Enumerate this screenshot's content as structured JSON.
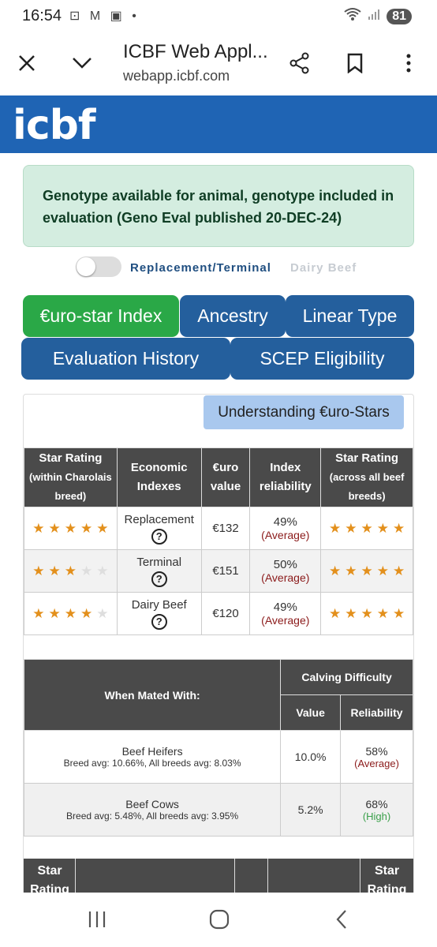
{
  "status_bar": {
    "time": "16:54",
    "notification_icons": "⊡ M ▣ •",
    "battery": "81"
  },
  "browser": {
    "title": "ICBF Web Appl...",
    "url": "webapp.icbf.com"
  },
  "logo_text": "icbf",
  "alert_text": "Genotype available for animal, genotype included in evaluation (Geno Eval published 20-DEC-24)",
  "toggle": {
    "label_on": "Replacement/Terminal",
    "label_off": "Dairy Beef"
  },
  "tabs": [
    {
      "label": "€uro-star Index"
    },
    {
      "label": "Ancestry"
    },
    {
      "label": "Linear Type"
    },
    {
      "label": "Evaluation History"
    },
    {
      "label": "SCEP Eligibility"
    }
  ],
  "understanding_button": "Understanding €uro-Stars",
  "index_table": {
    "headers": {
      "star_rating_within": "Star Rating",
      "star_rating_within_sub": "(within Charolais breed)",
      "economic_indexes": "Economic Indexes",
      "euro_value": "€uro value",
      "index_reliability": "Index reliability",
      "star_rating_across": "Star Rating",
      "star_rating_across_sub": "(across all beef breeds)"
    },
    "rows": [
      {
        "stars_within": 5,
        "index": "Replacement",
        "value": "€132",
        "reliability": "49%",
        "reliability_level": "(Average)",
        "stars_across": 5
      },
      {
        "stars_within": 3,
        "index": "Terminal",
        "value": "€151",
        "reliability": "50%",
        "reliability_level": "(Average)",
        "stars_across": 5
      },
      {
        "stars_within": 4,
        "index": "Dairy Beef",
        "value": "€120",
        "reliability": "49%",
        "reliability_level": "(Average)",
        "stars_across": 5
      }
    ],
    "help_glyph": "?"
  },
  "calving_table": {
    "mated_with_header": "When Mated With:",
    "calving_header": "Calving Difficulty",
    "value_header": "Value",
    "reliability_header": "Reliability",
    "rows": [
      {
        "label": "Beef Heifers",
        "sub": "Breed avg: 10.66%, All breeds avg: 8.03%",
        "value": "10.0%",
        "reliability": "58%",
        "reliability_level": "(Average)"
      },
      {
        "label": "Beef Cows",
        "sub": "Breed avg: 5.48%, All breeds avg: 3.95%",
        "value": "5.2%",
        "reliability": "68%",
        "reliability_level": "(High)"
      }
    ]
  },
  "partial_table": {
    "left_header": "Star Rating",
    "right_header": "Star Rating"
  },
  "colors": {
    "brand_blue": "#1f64b4",
    "tab_blue": "#245f9d",
    "tab_active_green": "#2aa847",
    "star": "#e3901c"
  }
}
